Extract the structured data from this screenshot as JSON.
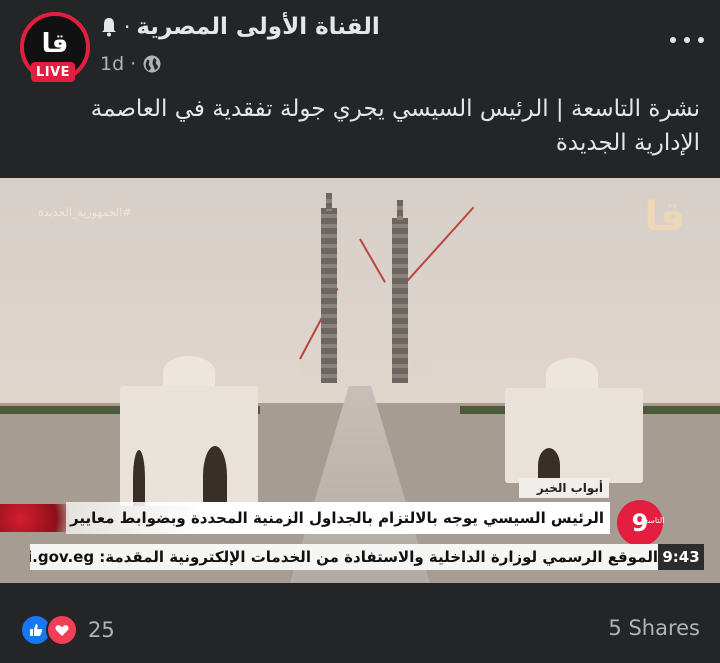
{
  "post": {
    "page_name": "القناة الأولى المصرية",
    "live_label": "LIVE",
    "avatar_logo": "قا",
    "time_ago": "1d",
    "separator": "·",
    "text": "نشرة التاسعة | الرئيس السيسي يجري جولة تفقدية في العاصمة الإدارية الجديدة"
  },
  "media": {
    "hashtag": "#الجمهورية_الجديدة",
    "watermark": "قا",
    "program_tag": "أبواب الخير",
    "headline": "الرئيس السيسي يوجه بالالتزام بالجداول الزمنية المحددة وبضوابط معايير الإنشاء الهندسية",
    "channel_logo": "9",
    "channel_logo_label": "التاسعة",
    "ticker": "الموقع الرسمي لوزارة الداخلية والاستفادة من الخدمات الإلكترونية المقدمة: moi.gov.eg أو تحم",
    "clock": "9:43"
  },
  "footer": {
    "reaction_count": "25",
    "shares": "5 Shares"
  },
  "colors": {
    "background": "#242526",
    "live_red": "#e41e3f",
    "like_blue": "#1877f2",
    "love_red": "#f33e58"
  },
  "icons": [
    "bell-icon",
    "globe-icon",
    "more-icon",
    "like-icon",
    "love-icon"
  ]
}
